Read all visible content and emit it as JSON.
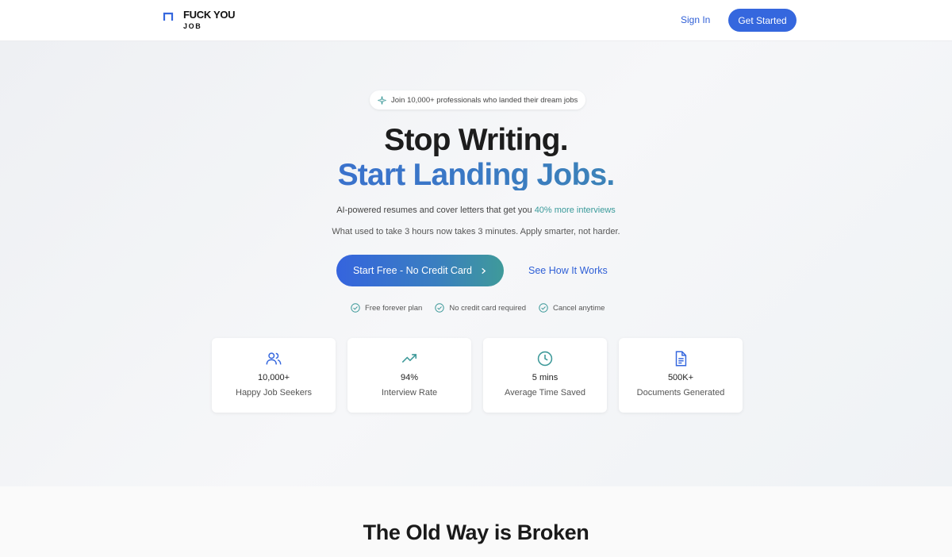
{
  "header": {
    "logo_line1": "FUCK YOU",
    "logo_line2": "JOB",
    "signin_label": "Sign In",
    "getstarted_label": "Get Started"
  },
  "hero": {
    "badge_text": "Join 10,000+ professionals who landed their dream jobs",
    "headline_line1": "Stop Writing.",
    "headline_line2": "Start Landing Jobs.",
    "subtitle_prefix": "AI-powered resumes and cover letters that get you ",
    "subtitle_highlight": "40% more interviews",
    "subtitle2": "What used to take 3 hours now takes 3 minutes. Apply smarter, not harder.",
    "cta_primary": "Start Free - No Credit Card",
    "cta_secondary": "See How It Works",
    "perks": [
      "Free forever plan",
      "No credit card required",
      "Cancel anytime"
    ]
  },
  "stats": [
    {
      "icon": "users-icon",
      "value": "10,000+",
      "label": "Happy Job Seekers"
    },
    {
      "icon": "trending-up-icon",
      "value": "94%",
      "label": "Interview Rate"
    },
    {
      "icon": "clock-icon",
      "value": "5 mins",
      "label": "Average Time Saved"
    },
    {
      "icon": "document-icon",
      "value": "500K+",
      "label": "Documents Generated"
    }
  ],
  "section2": {
    "title": "The Old Way is Broken"
  },
  "colors": {
    "brand_blue": "#3567de",
    "accent_teal": "#3f9a9a"
  }
}
